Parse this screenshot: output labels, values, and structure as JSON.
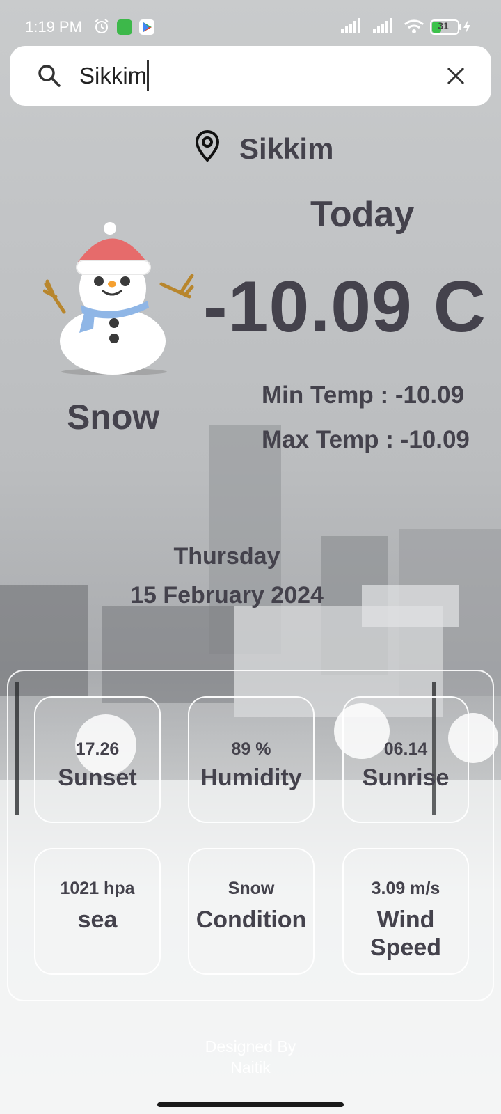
{
  "status_bar": {
    "time": "1:19 PM",
    "battery": "31",
    "icons": [
      "alarm-icon",
      "app-notification-icon",
      "play-store-icon",
      "signal-icon",
      "signal-icon",
      "wifi-icon",
      "battery-icon",
      "charging-icon"
    ]
  },
  "search": {
    "value": "Sikkim",
    "icon": "search-icon",
    "clear_icon": "close-icon"
  },
  "location": {
    "name": "Sikkim",
    "icon": "location-pin-icon"
  },
  "weather": {
    "today_label": "Today",
    "temperature": "-10.09 C",
    "condition": "Snow",
    "condition_icon": "snowman-icon",
    "min_temp": "Min Temp : -10.09",
    "max_temp": "Max Temp : -10.09"
  },
  "date": {
    "day": "Thursday",
    "full": "15 February 2024"
  },
  "stats": [
    {
      "value": "17.26",
      "label": "Sunset"
    },
    {
      "value": "89 %",
      "label": "Humidity"
    },
    {
      "value": "06.14",
      "label": "Sunrise"
    },
    {
      "value": "1021 hpa",
      "label": "sea"
    },
    {
      "value": "Snow",
      "label": "Condition"
    },
    {
      "value": "3.09 m/s",
      "label": "Wind Speed"
    }
  ],
  "footer": {
    "line1": "Designed By",
    "line2": "Naitik"
  },
  "colors": {
    "text": "#44424c",
    "card_border": "#ffffff",
    "search_bg": "#ffffff"
  }
}
